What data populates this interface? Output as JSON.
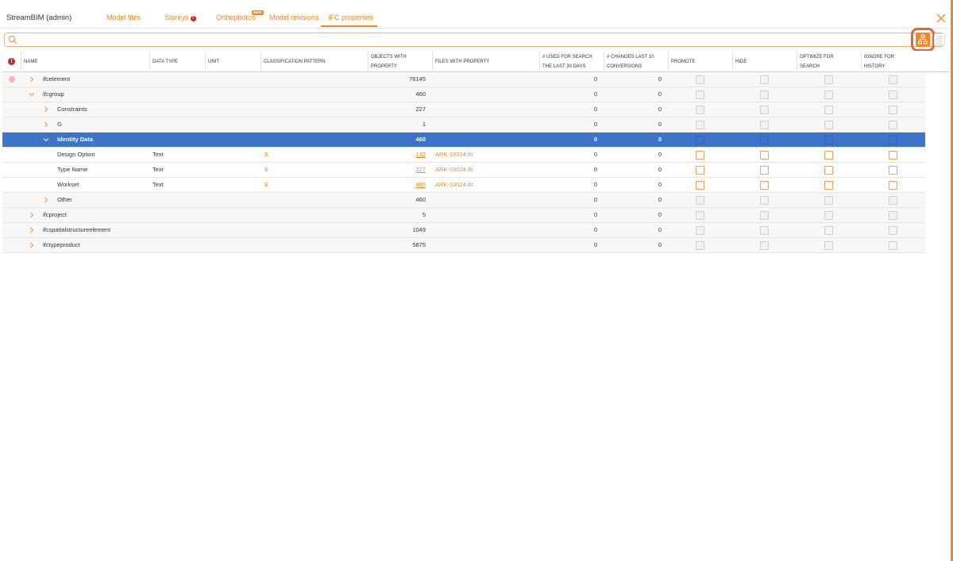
{
  "header": {
    "app_title": "StreamBIM (admin)",
    "tabs": [
      {
        "label": "Model files"
      },
      {
        "label": "Storeys",
        "alert": "!"
      },
      {
        "label": "Orthophotos",
        "badge": "NEW"
      },
      {
        "label": "Model revisions"
      },
      {
        "label": "IFC properties",
        "active": true
      }
    ]
  },
  "search": {
    "placeholder": "",
    "value": ""
  },
  "colors": {
    "accent": "#f0892a",
    "selected_row": "#3b74c9",
    "alert": "#c62828"
  },
  "table": {
    "header_alert": "!",
    "columns": [
      {
        "line1": "Name",
        "line2": ""
      },
      {
        "line1": "Data type",
        "line2": ""
      },
      {
        "line1": "Unit",
        "line2": ""
      },
      {
        "line1": "Classification pattern",
        "line2": ""
      },
      {
        "line1": "Objects with",
        "line2": "property"
      },
      {
        "line1": "Files with property",
        "line2": ""
      },
      {
        "line1": "# used for search",
        "line2": "the last 30 days"
      },
      {
        "line1": "# changes last 10",
        "line2": "conversions"
      },
      {
        "line1": "Promote",
        "line2": ""
      },
      {
        "line1": "Hide",
        "line2": ""
      },
      {
        "line1": "Optimize for",
        "line2": "search"
      },
      {
        "line1": "Ignore for",
        "line2": "history"
      }
    ],
    "rows": [
      {
        "name": "ifcelement",
        "level": 0,
        "expand": "collapsed",
        "datatype": "",
        "pattern": "",
        "objects": "76145",
        "objects_link": false,
        "files": "",
        "search30": "0",
        "changes10": "0",
        "alert": true
      },
      {
        "name": "ifcgroup",
        "level": 0,
        "expand": "expanded",
        "datatype": "",
        "pattern": "",
        "objects": "460",
        "objects_link": false,
        "files": "",
        "search30": "0",
        "changes10": "0"
      },
      {
        "name": "Constraints",
        "level": 1,
        "expand": "collapsed",
        "datatype": "",
        "pattern": "",
        "objects": "227",
        "objects_link": false,
        "files": "",
        "search30": "0",
        "changes10": "0"
      },
      {
        "name": "G",
        "level": 1,
        "expand": "collapsed",
        "datatype": "",
        "pattern": "",
        "objects": "1",
        "objects_link": false,
        "files": "",
        "search30": "0",
        "changes10": "0"
      },
      {
        "name": "Identity Data",
        "level": 1,
        "expand": "expanded",
        "datatype": "",
        "pattern": "",
        "objects": "460",
        "objects_link": false,
        "files": "",
        "search30": "0",
        "changes10": "0",
        "selected": true
      },
      {
        "name": "Design Option",
        "level": 2,
        "expand": "none",
        "datatype": "Text",
        "pattern": "$",
        "objects": "132",
        "objects_link": true,
        "files": "ARK-10024.ifc",
        "search30": "0",
        "changes10": "0"
      },
      {
        "name": "Type Name",
        "level": 2,
        "expand": "none",
        "datatype": "Text",
        "pattern": "$",
        "objects": "227",
        "objects_link": true,
        "files": "ARK-10024.ifc",
        "search30": "0",
        "changes10": "0"
      },
      {
        "name": "Workset",
        "level": 2,
        "expand": "none",
        "datatype": "Text",
        "pattern": "$",
        "objects": "460",
        "objects_link": true,
        "files": "ARK-10024.ifc",
        "search30": "0",
        "changes10": "0"
      },
      {
        "name": "Other",
        "level": 1,
        "expand": "collapsed",
        "datatype": "",
        "pattern": "",
        "objects": "460",
        "objects_link": false,
        "files": "",
        "search30": "0",
        "changes10": "0"
      },
      {
        "name": "ifcproject",
        "level": 0,
        "expand": "collapsed",
        "datatype": "",
        "pattern": "",
        "objects": "5",
        "objects_link": false,
        "files": "",
        "search30": "0",
        "changes10": "0"
      },
      {
        "name": "ifcspatialstructureelement",
        "level": 0,
        "expand": "collapsed",
        "datatype": "",
        "pattern": "",
        "objects": "1049",
        "objects_link": false,
        "files": "",
        "search30": "0",
        "changes10": "0"
      },
      {
        "name": "ifctypeproduct",
        "level": 0,
        "expand": "collapsed",
        "datatype": "",
        "pattern": "",
        "objects": "5875",
        "objects_link": false,
        "files": "",
        "search30": "0",
        "changes10": "0"
      }
    ]
  }
}
